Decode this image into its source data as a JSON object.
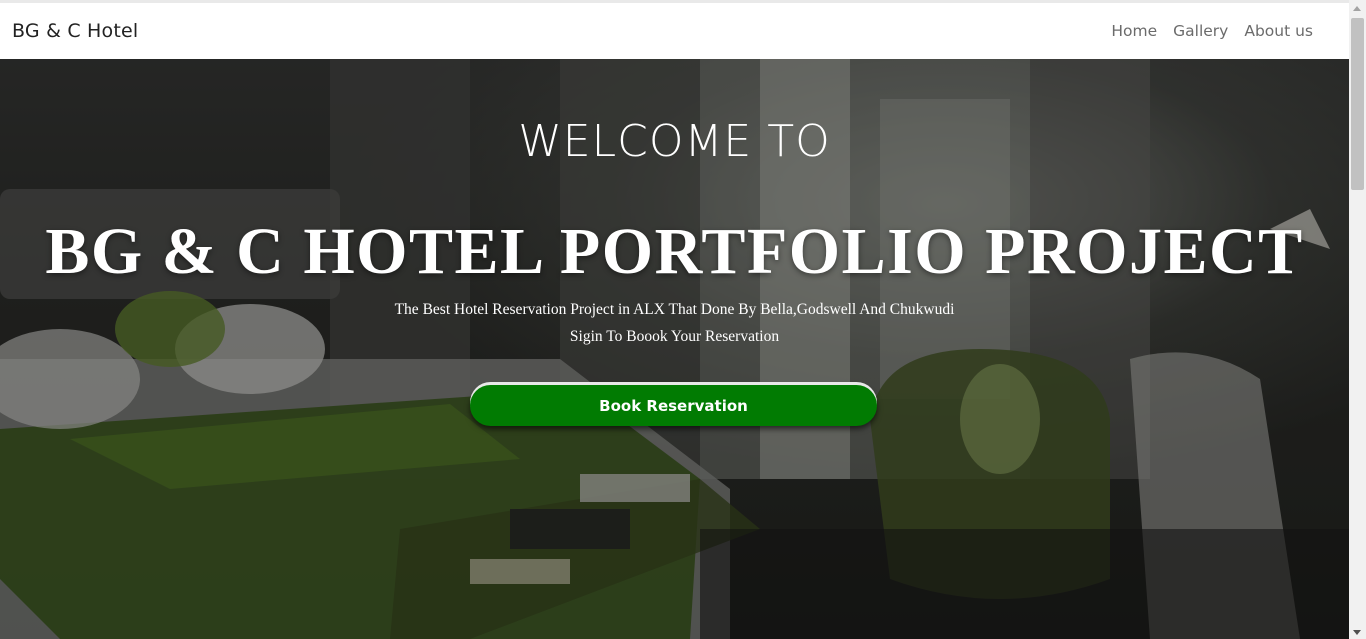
{
  "navbar": {
    "brand": "BG & C Hotel",
    "links": [
      {
        "label": "Home"
      },
      {
        "label": "Gallery"
      },
      {
        "label": "About us"
      }
    ]
  },
  "hero": {
    "welcome": "WELCOME TO",
    "title": "BG & C HOTEL PORTFOLIO PROJECT",
    "subtitle": "The Best Hotel Reservation Project in ALX That Done By Bella,Godswell And Chukwudi",
    "cta_text": "Sigin To Boook Your Reservation",
    "button_label": "Book Reservation",
    "button_color": "#017b02",
    "background_image": "hotel-bedroom-photo"
  },
  "scrollbar": {
    "up_icon": "chevron-up-icon",
    "down_icon": "chevron-down-icon"
  }
}
